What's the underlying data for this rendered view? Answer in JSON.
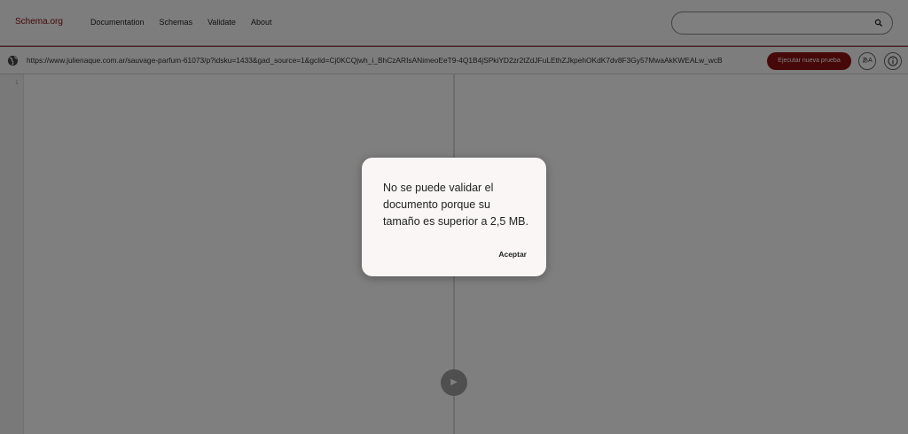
{
  "header": {
    "logo": "Schema.org",
    "nav": [
      "Documentation",
      "Schemas",
      "Validate",
      "About"
    ],
    "search_placeholder": ""
  },
  "toolbar": {
    "url": "https://www.julienaque.com.ar/sauvage-parfum-61073/p?idsku=1433&gad_source=1&gclid=Cj0KCQjwh_i_BhCzARIsANimeoEeT9-4Q1B4jSPkiYD2zr2tZdJFuLEthZJkpehOKdK7dv8F3Gy57MwaAkKWEALw_wcB",
    "run_label": "Ejecutar nueva prueba",
    "lang_label": "あA",
    "info_icon": "info-icon",
    "globe_icon": "globe-icon"
  },
  "editor": {
    "line_number": "1",
    "play_icon": "play-icon"
  },
  "dialog": {
    "message": "No se puede validar el documento porque su tamaño es superior a 2,5 MB.",
    "accept_label": "Aceptar"
  },
  "colors": {
    "brand": "#8d0d0d",
    "overlay": "rgba(0,0,0,0.5)"
  }
}
